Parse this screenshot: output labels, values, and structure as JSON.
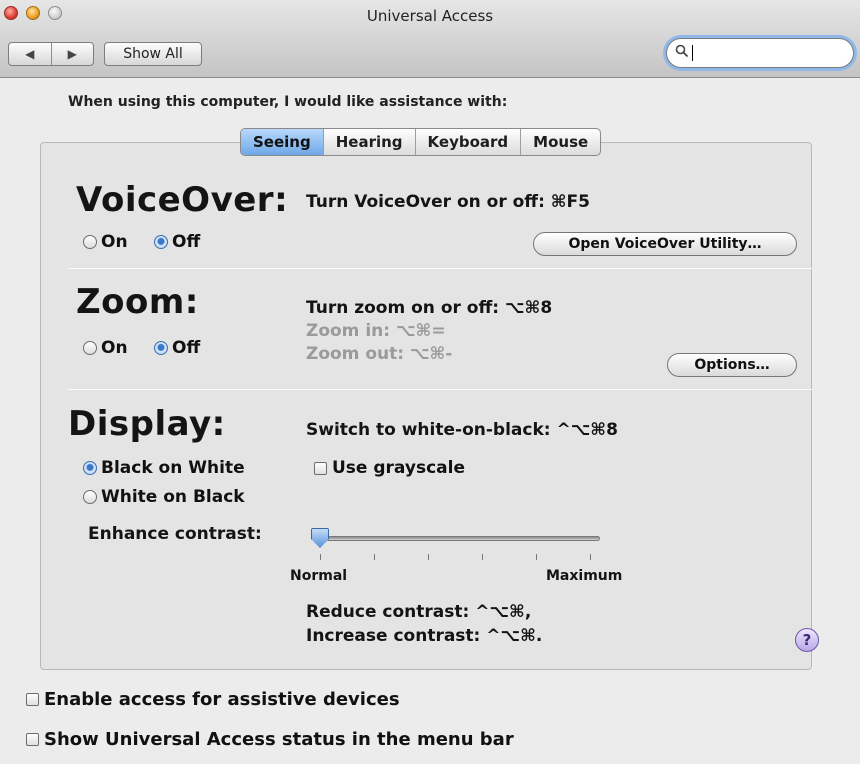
{
  "window": {
    "title": "Universal Access"
  },
  "toolbar": {
    "back_symbol": "◀",
    "forward_symbol": "▶",
    "show_all_label": "Show All",
    "search_symbol": "🔍",
    "search_value": ""
  },
  "intro_text": "When using this computer, I would like assistance with:",
  "tabs": [
    {
      "label": "Seeing",
      "active": true
    },
    {
      "label": "Hearing",
      "active": false
    },
    {
      "label": "Keyboard",
      "active": false
    },
    {
      "label": "Mouse",
      "active": false
    }
  ],
  "voiceover": {
    "heading": "VoiceOver:",
    "shortcut": "Turn VoiceOver on or off: ⌘F5",
    "on_label": "On",
    "off_label": "Off",
    "selected": "Off",
    "utility_button": "Open VoiceOver Utility…"
  },
  "zoom": {
    "heading": "Zoom:",
    "shortcut": "Turn zoom on or off: ⌥⌘8",
    "zoom_in": "Zoom in: ⌥⌘=",
    "zoom_out": "Zoom out: ⌥⌘-",
    "on_label": "On",
    "off_label": "Off",
    "selected": "Off",
    "options_button": "Options…"
  },
  "display": {
    "heading": "Display:",
    "shortcut": "Switch to white-on-black: ^⌥⌘8",
    "black_on_white": "Black on White",
    "white_on_black": "White on Black",
    "selected": "Black on White",
    "grayscale_label": "Use grayscale",
    "grayscale_checked": false,
    "contrast_label": "Enhance contrast:",
    "contrast_value": 0,
    "slider_min_label": "Normal",
    "slider_max_label": "Maximum",
    "reduce_contrast": "Reduce contrast: ^⌥⌘,",
    "increase_contrast": "Increase contrast: ^⌥⌘."
  },
  "help_symbol": "?",
  "bottom": {
    "assistive_label": "Enable access for assistive devices",
    "assistive_checked": false,
    "menubar_label": "Show Universal Access status in the menu bar",
    "menubar_checked": false
  }
}
